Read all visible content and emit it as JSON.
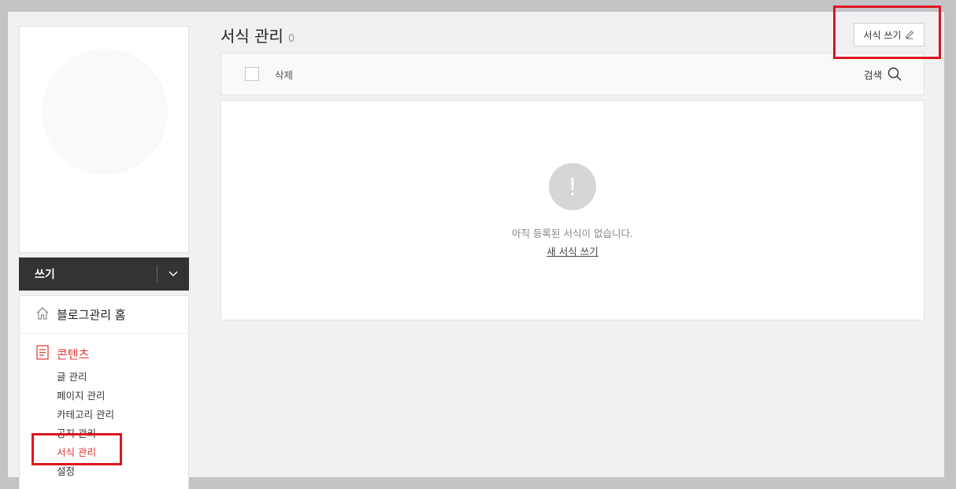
{
  "sidebar": {
    "write_label": "쓰기",
    "home_label": "블로그관리 홈",
    "section_label": "콘텐츠",
    "items": [
      {
        "label": "글 관리"
      },
      {
        "label": "페이지 관리"
      },
      {
        "label": "카테고리 관리"
      },
      {
        "label": "공지 관리"
      },
      {
        "label": "서식 관리"
      },
      {
        "label": "설정"
      }
    ]
  },
  "main": {
    "title": "서식 관리",
    "count": "0",
    "write_button": "서식 쓰기",
    "delete_label": "삭제",
    "search_label": "검색",
    "empty_message": "아직 등록된 서식이 없습니다.",
    "new_link": "새 서식 쓰기",
    "alert_glyph": "!"
  },
  "colors": {
    "accent": "#e0362f",
    "highlight": "#e0141f",
    "dark_bar": "#333333"
  }
}
